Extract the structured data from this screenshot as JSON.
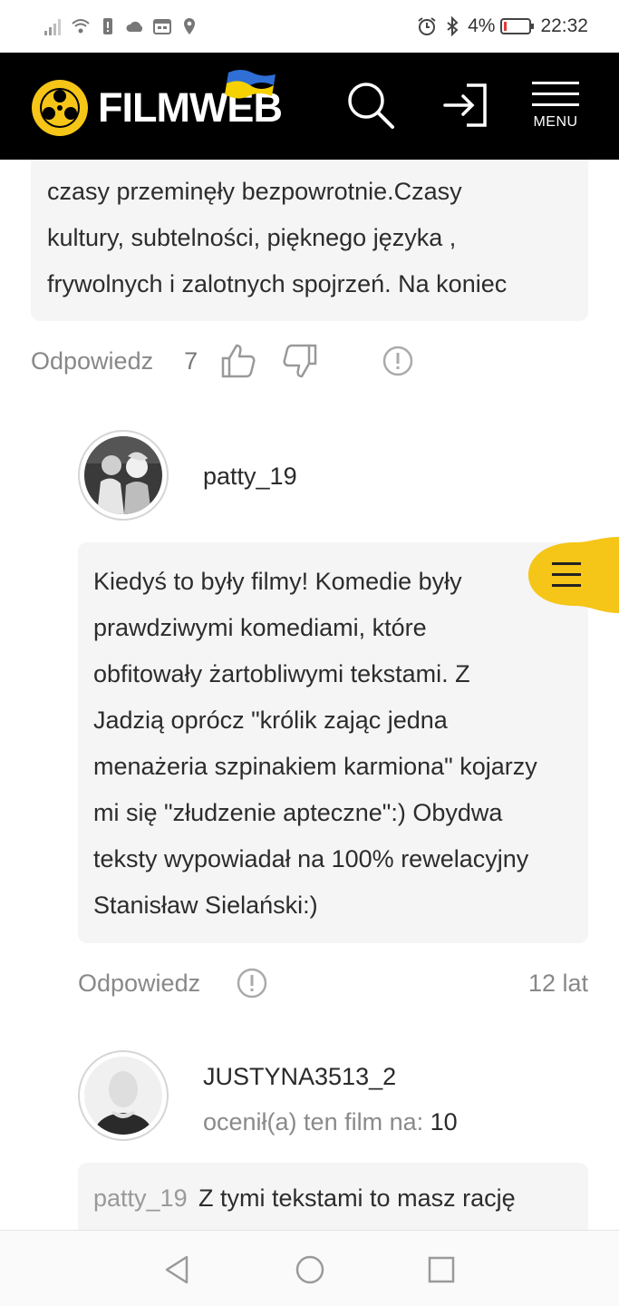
{
  "status_bar": {
    "battery_percent": "4%",
    "time": "22:32"
  },
  "header": {
    "logo_text": "FILMWEB",
    "menu_label": "MENU"
  },
  "comment_prev": {
    "lines": [
      "czasy przeminęły bezpowrotnie.Czasy",
      "kultury, subtelności, pięknego języka ,",
      "frywolnych i zalotnych spojrzeń. Na koniec"
    ],
    "reply_label": "Odpowiedz",
    "like_count": "7"
  },
  "comment_patty": {
    "username": "patty_19",
    "lines": [
      "Kiedyś to były filmy! Komedie były",
      "prawdziwymi komediami, które",
      "obfitowały żartobliwymi tekstami. Z",
      "Jadzią oprócz \"królik zając jedna",
      "menażeria szpinakiem karmiona\" kojarzy",
      "mi się \"złudzenie apteczne\":) Obydwa",
      "teksty wypowiadał na 100% rewelacyjny",
      "Stanisław Sielański:)"
    ],
    "reply_label": "Odpowiedz",
    "age": "12 lat"
  },
  "comment_justyna": {
    "username": "JUSTYNA3513_2",
    "rating_prefix": "ocenił(a) ten film na:",
    "rating_value": "10",
    "quote_user": "patty_19",
    "text": "Z tymi tekstami to masz rację"
  },
  "colors": {
    "accent": "#f5c518",
    "header_bg": "#000000",
    "bubble_bg": "#f5f5f5"
  }
}
